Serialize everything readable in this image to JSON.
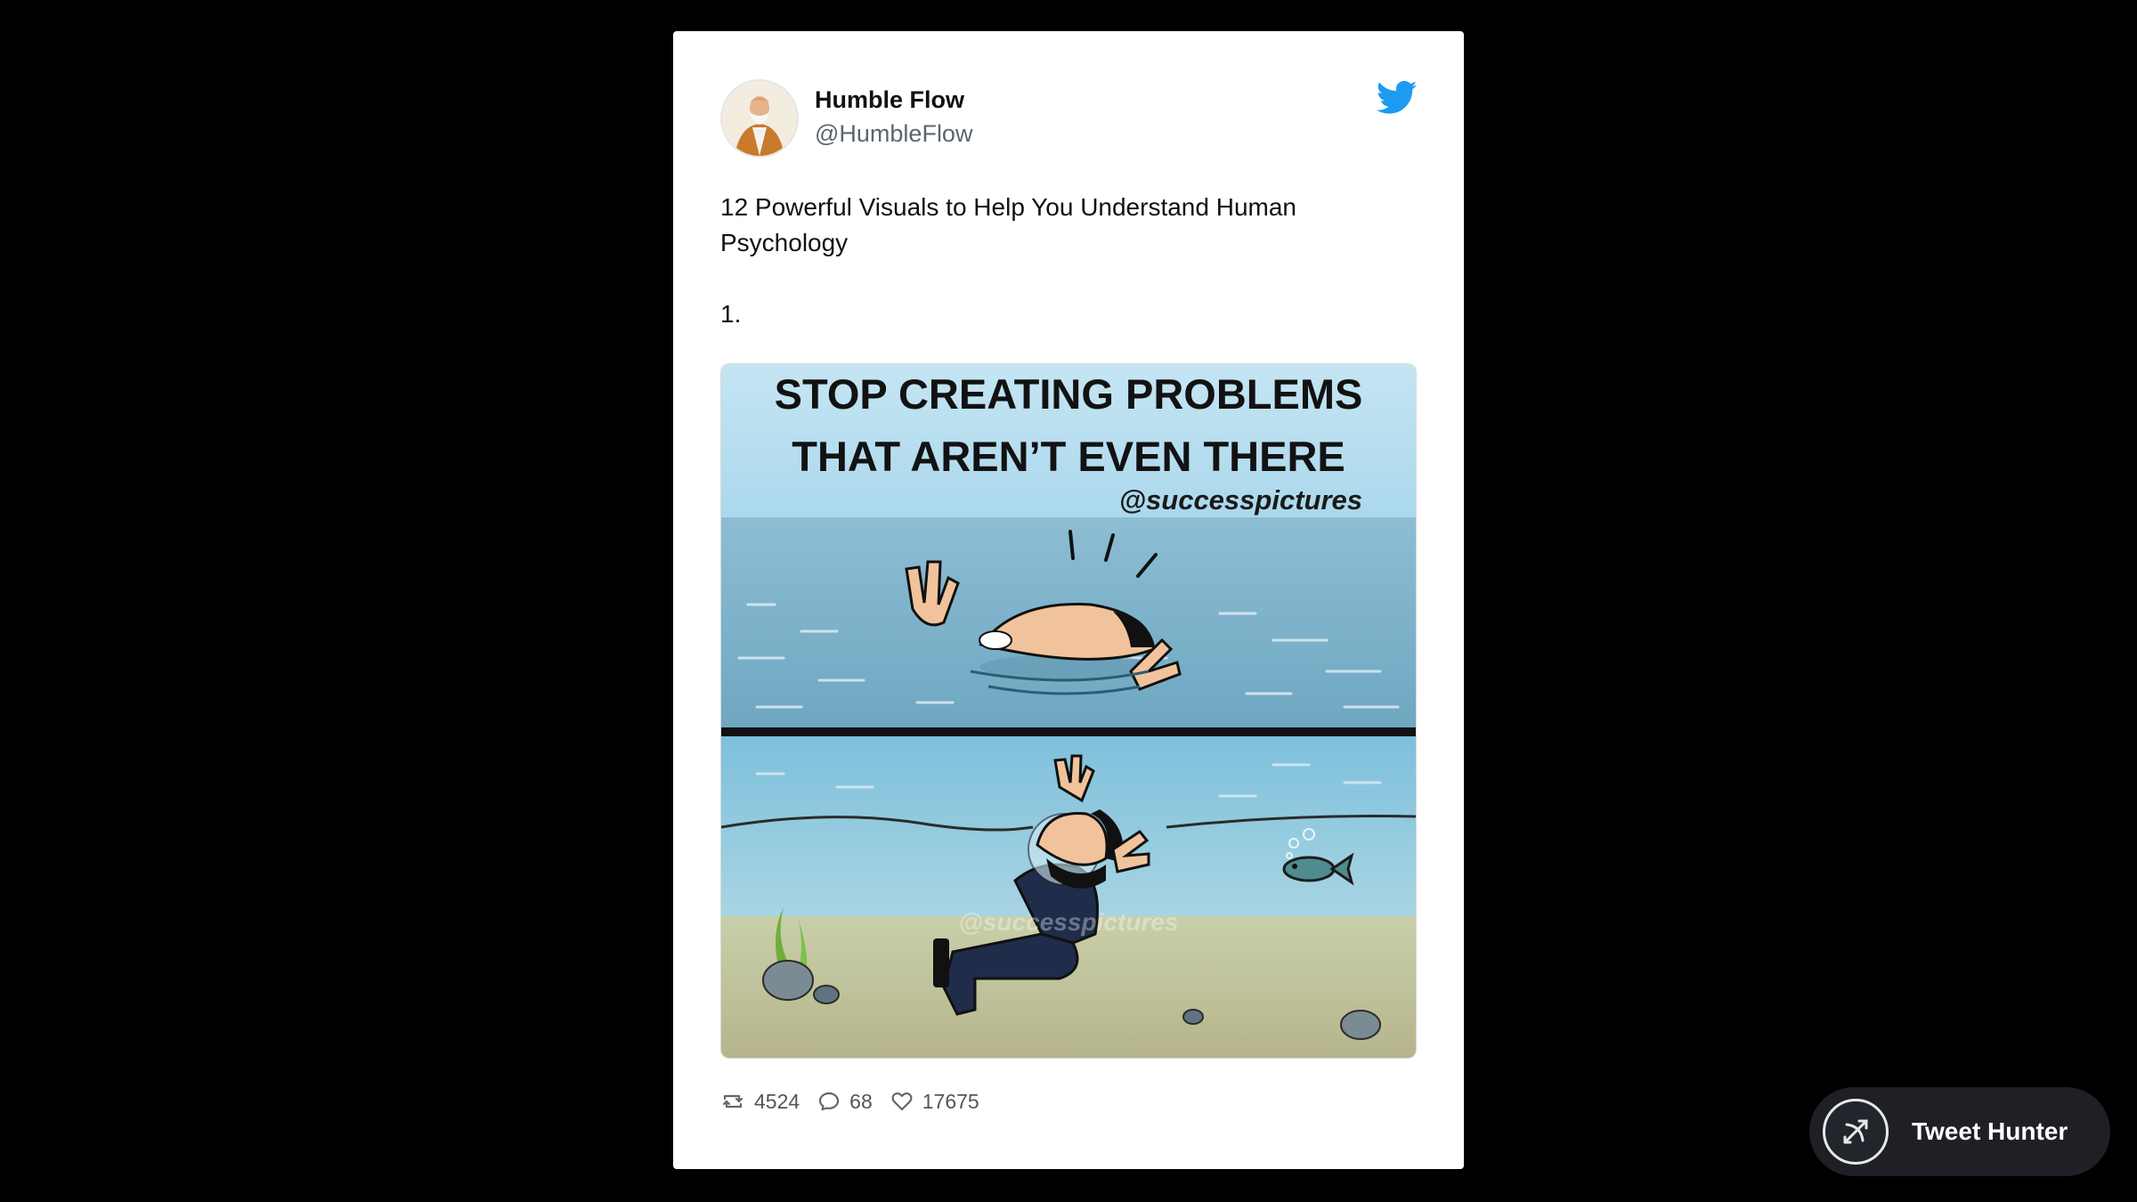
{
  "tweet": {
    "author_name": "Humble Flow",
    "author_handle": "@HumbleFlow",
    "text_line": "12 Powerful Visuals to Help You Understand Human Psychology",
    "text_number": "1.",
    "image": {
      "headline_line1": "STOP CREATING PROBLEMS",
      "headline_line2": "THAT AREN’T EVEN THERE",
      "credit": "@successpictures",
      "watermark": "@successpictures"
    },
    "stats": {
      "retweets": "4524",
      "replies": "68",
      "likes": "17675"
    },
    "icons": {
      "platform": "twitter-bird-icon",
      "retweet": "retweet-icon",
      "reply": "reply-icon",
      "like": "heart-icon"
    }
  },
  "branding": {
    "label": "Tweet Hunter",
    "icon": "tweet-hunter-icon"
  },
  "colors": {
    "background": "#000000",
    "card": "#ffffff",
    "twitter_blue": "#1d9bf0",
    "badge": "#1e2026"
  }
}
